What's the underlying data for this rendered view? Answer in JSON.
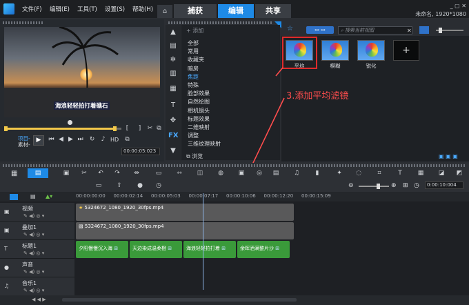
{
  "menubar": {
    "items": [
      "文件(F)",
      "编辑(E)",
      "工具(T)",
      "设置(S)",
      "帮助(H)"
    ]
  },
  "tabs": [
    "捕获",
    "编辑",
    "共享"
  ],
  "project": {
    "name_res": "未命名, 1920*1080"
  },
  "player": {
    "subtitle": "海浪轻轻拍打着礁石",
    "project_label": "项目-",
    "clip_label": "素材-",
    "hd": "HD",
    "timecode": "00:00:05:023"
  },
  "library": {
    "add_label": "添加",
    "search_placeholder": "搜索当前视图",
    "browse_label": "浏览",
    "categories": [
      "全部",
      "常用",
      "收藏夹",
      "暗房",
      "焦距",
      "特殊",
      "脸部效果",
      "自然绘图",
      "相机镜头",
      "标题效果",
      "二维映射",
      "调整",
      "三维纹理映射"
    ],
    "selected_category": "焦距",
    "filters": [
      {
        "label": "平均"
      },
      {
        "label": "模糊"
      },
      {
        "label": "锐化"
      }
    ]
  },
  "annotation": "3.添加平均滤镜",
  "timeline": {
    "zoom_time": "0:00:10:004",
    "ruler": [
      "00:00:00:00",
      "00:00:02:14",
      "00:00:05:03",
      "00:00:07:17",
      "00:00:10:06",
      "00:00:12:20",
      "00:00:15:09"
    ],
    "tracks": [
      "视频",
      "叠加1",
      "标题1",
      "声音",
      "音乐1"
    ],
    "video_clip": "5324672_1080_1920_30fps.mp4",
    "overlay_clip": "5324672_1080_1920_30fps.mp4",
    "titles": [
      "夕阳慢慢沉入海",
      "天边染成温柔橙",
      "海浪轻轻拍打着",
      "余晖洒满整片沙"
    ]
  }
}
